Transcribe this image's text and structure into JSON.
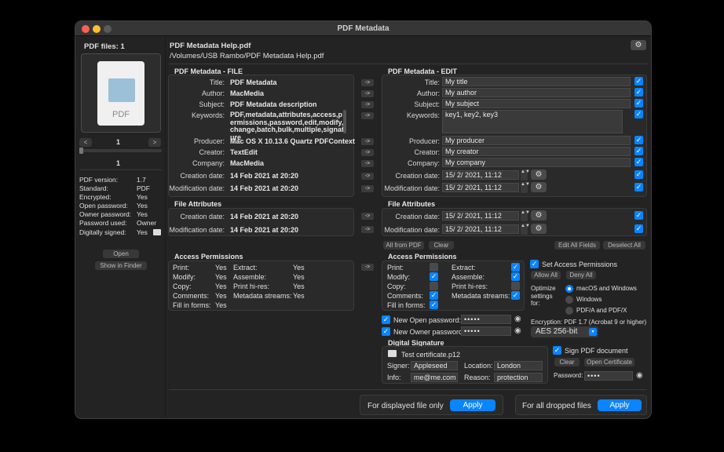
{
  "window": {
    "title": "PDF Metadata"
  },
  "sidebar": {
    "pdf_files_label": "PDF files: 1",
    "thumbnail_label": "PDF",
    "page_nav": {
      "prev": "<",
      "page": "1",
      "next": ">"
    },
    "page_number": "1",
    "info": [
      {
        "k": "PDF version:",
        "v": "1.7"
      },
      {
        "k": "Standard:",
        "v": "PDF"
      },
      {
        "k": "Encrypted:",
        "v": "Yes"
      },
      {
        "k": "Open password:",
        "v": "Yes"
      },
      {
        "k": "Owner password:",
        "v": "Yes"
      },
      {
        "k": "Password used:",
        "v": "Owner"
      },
      {
        "k": "Digitally signed:",
        "v": "Yes"
      }
    ],
    "open_button": "Open",
    "show_in_finder_button": "Show in Finder"
  },
  "header": {
    "filename": "PDF Metadata Help.pdf",
    "path": "/Volumes/USB Rambo/PDF Metadata Help.pdf"
  },
  "file_meta": {
    "title": "PDF Metadata - FILE",
    "rows": [
      {
        "label": "Title:",
        "value": "PDF Metadata"
      },
      {
        "label": "Author:",
        "value": "MacMedia"
      },
      {
        "label": "Subject:",
        "value": "PDF Metadata description"
      },
      {
        "label": "Keywords:",
        "value": "PDF,metadata,attributes,access,permissions,password,edit,modify,change,batch,bulk,multiple,signature"
      },
      {
        "label": "Producer:",
        "value": "Mac OS X 10.13.6 Quartz PDFContext"
      },
      {
        "label": "Creator:",
        "value": "TextEdit"
      },
      {
        "label": "Company:",
        "value": "MacMedia"
      },
      {
        "label": "Creation date:",
        "value": "14 Feb 2021 at 20:20"
      },
      {
        "label": "Modification date:",
        "value": "14 Feb 2021 at 20:20"
      }
    ]
  },
  "file_attrs": {
    "title": "File Attributes",
    "rows": [
      {
        "label": "Creation date:",
        "value": "14 Feb 2021 at 20:20"
      },
      {
        "label": "Modification date:",
        "value": "14 Feb 2021 at 20:20"
      }
    ]
  },
  "arrow_label": "->",
  "edit_meta": {
    "title": "PDF Metadata - EDIT",
    "rows": [
      {
        "label": "Title:",
        "value": "My title"
      },
      {
        "label": "Author:",
        "value": "My author"
      },
      {
        "label": "Subject:",
        "value": "My subject"
      },
      {
        "label": "Keywords:",
        "value": "key1, key2, key3"
      },
      {
        "label": "Producer:",
        "value": "My producer"
      },
      {
        "label": "Creator:",
        "value": "My creator"
      },
      {
        "label": "Company:",
        "value": "My company"
      },
      {
        "label": "Creation date:",
        "value": "15/  2/ 2021,  11:12"
      },
      {
        "label": "Modification date:",
        "value": "15/  2/ 2021,  11:12"
      }
    ]
  },
  "edit_attrs": {
    "title": "File Attributes",
    "rows": [
      {
        "label": "Creation date:",
        "value": "15/  2/ 2021,  11:12"
      },
      {
        "label": "Modification date:",
        "value": "15/  2/ 2021,  11:12"
      }
    ]
  },
  "buttons": {
    "all_from_pdf": "All from PDF",
    "clear": "Clear",
    "edit_all_fields": "Edit All Fields",
    "deselect_all": "Deselect All"
  },
  "file_perms": {
    "title": "Access Permissions",
    "left": [
      {
        "k": "Print:",
        "v": "Yes"
      },
      {
        "k": "Modify:",
        "v": "Yes"
      },
      {
        "k": "Copy:",
        "v": "Yes"
      },
      {
        "k": "Comments:",
        "v": "Yes"
      },
      {
        "k": "Fill in forms:",
        "v": "Yes"
      }
    ],
    "right": [
      {
        "k": "Extract:",
        "v": "Yes"
      },
      {
        "k": "Assemble:",
        "v": "Yes"
      },
      {
        "k": "Print hi-res:",
        "v": "Yes"
      },
      {
        "k": "Metadata streams:",
        "v": "Yes"
      }
    ]
  },
  "edit_perms": {
    "title": "Access Permissions",
    "left": [
      {
        "k": "Print:",
        "checked": false
      },
      {
        "k": "Modify:",
        "checked": true
      },
      {
        "k": "Copy:",
        "checked": false
      },
      {
        "k": "Comments:",
        "checked": true
      },
      {
        "k": "Fill in forms:",
        "checked": true
      }
    ],
    "right": [
      {
        "k": "Extract:",
        "checked": true
      },
      {
        "k": "Assemble:",
        "checked": true
      },
      {
        "k": "Print hi-res:",
        "checked": false
      },
      {
        "k": "Metadata streams:",
        "checked": true
      }
    ]
  },
  "set_access": {
    "label": "Set Access Permissions",
    "allow_all": "Allow All",
    "deny_all": "Deny All",
    "optimize_label": "Optimize settings for:",
    "options": [
      "macOS and Windows",
      "Windows",
      "PDF/A and PDF/X"
    ],
    "encryption_label": "Encryption: PDF 1.7 (Acrobat 9 or higher)",
    "encryption_value": "AES 256-bit"
  },
  "passwords": {
    "open_label": "New Open password:",
    "open_value": "•••••",
    "owner_label": "New Owner password:",
    "owner_value": "•••••"
  },
  "signature": {
    "title": "Digital Signature",
    "certificate": "Test certificate.p12",
    "signer_label": "Signer:",
    "signer_value": "Appleseed",
    "location_label": "Location:",
    "location_value": "London",
    "info_label": "Info:",
    "info_value": "me@me.com",
    "reason_label": "Reason:",
    "reason_value": "protection",
    "sign_label": "Sign PDF document",
    "clear": "Clear",
    "open_certificate": "Open Certificate",
    "password_label": "Password:",
    "password_value": "••••"
  },
  "footer": {
    "displayed_label": "For displayed file only",
    "dropped_label": "For all dropped files",
    "apply": "Apply"
  },
  "colors": {
    "accent": "#0a84ff",
    "window": "#232323",
    "panel": "#2a2a2a"
  }
}
